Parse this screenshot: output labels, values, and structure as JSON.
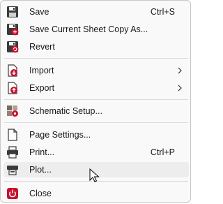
{
  "menu": {
    "items": [
      {
        "label": "Save",
        "shortcut": "Ctrl+S",
        "icon": "save-icon"
      },
      {
        "label": "Save Current Sheet Copy As...",
        "shortcut": "",
        "icon": "save-copy-icon"
      },
      {
        "label": "Revert",
        "shortcut": "",
        "icon": "revert-icon"
      },
      {
        "label": "Import",
        "shortcut": "",
        "icon": "import-icon",
        "submenu": true
      },
      {
        "label": "Export",
        "shortcut": "",
        "icon": "export-icon",
        "submenu": true
      },
      {
        "label": "Schematic Setup...",
        "shortcut": "",
        "icon": "schematic-setup-icon"
      },
      {
        "label": "Page Settings...",
        "shortcut": "",
        "icon": "page-settings-icon"
      },
      {
        "label": "Print...",
        "shortcut": "Ctrl+P",
        "icon": "print-icon"
      },
      {
        "label": "Plot...",
        "shortcut": "",
        "icon": "plot-icon",
        "hovered": true
      },
      {
        "label": "Close",
        "shortcut": "",
        "icon": "close-power-icon"
      }
    ]
  },
  "colors": {
    "accent_red": "#c8102e",
    "icon_dark": "#3a3a3a",
    "hover_bg": "#ededed"
  }
}
